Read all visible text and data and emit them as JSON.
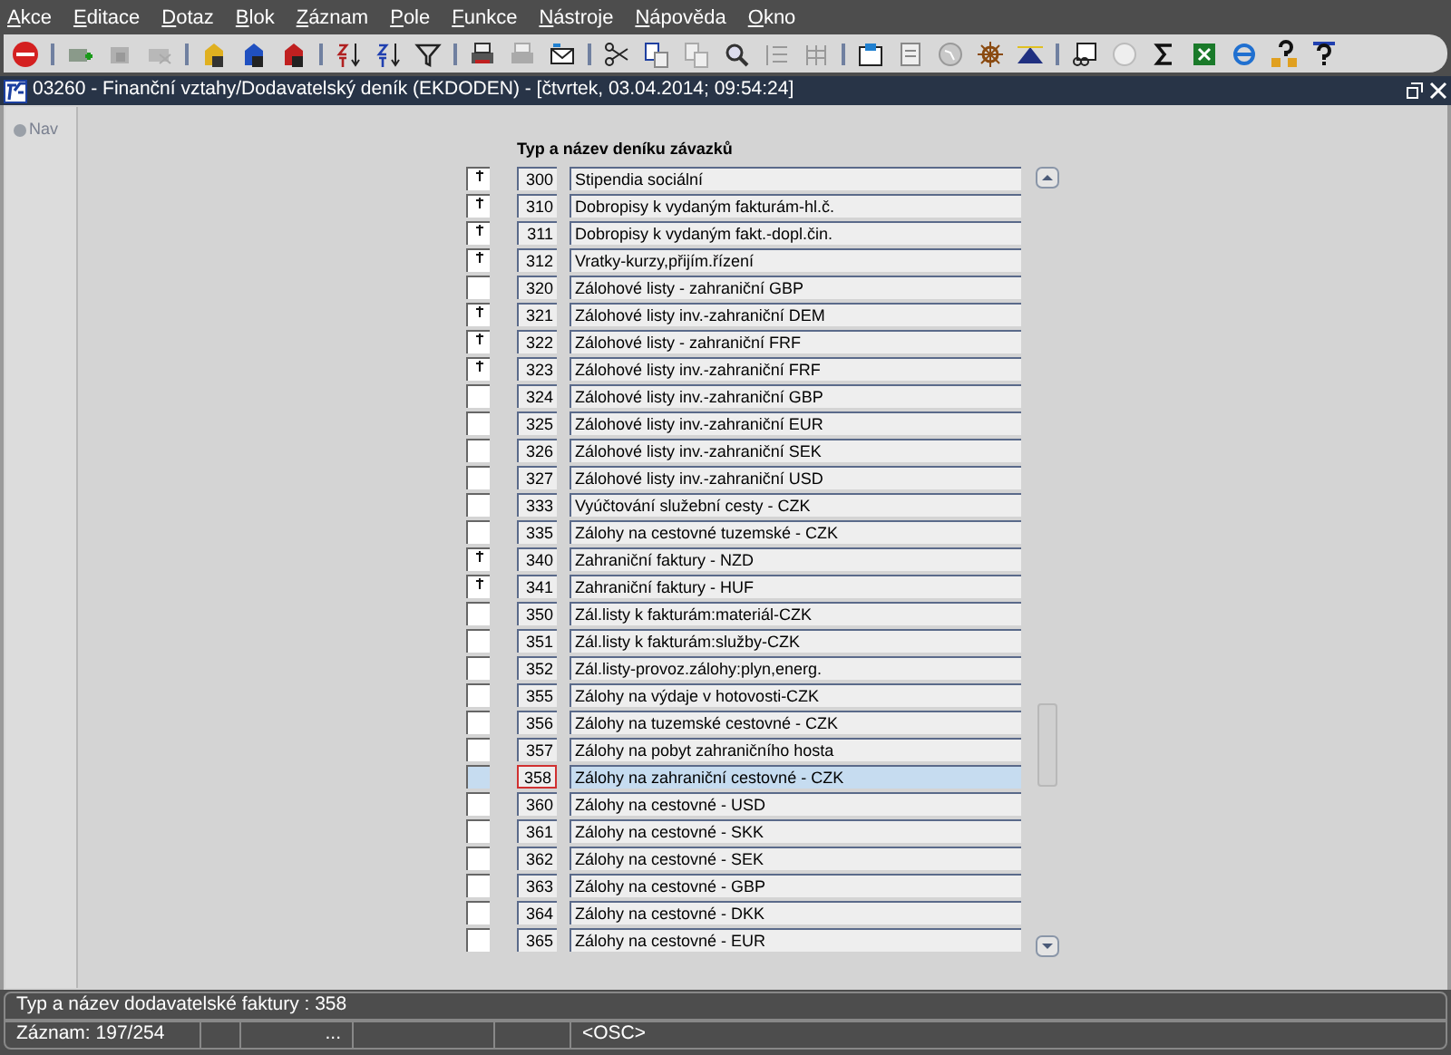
{
  "menu": [
    "Akce",
    "Editace",
    "Dotaz",
    "Blok",
    "Záznam",
    "Pole",
    "Funkce",
    "Nástroje",
    "Nápověda",
    "Okno"
  ],
  "window": {
    "title": "03260 - Finanční vztahy/Dodavatelský deník (EKDODEN) - [čtvrtek, 03.04.2014; 09:54:24]"
  },
  "nav": {
    "label": "Nav"
  },
  "list": {
    "heading": "Typ a název deníku závazků",
    "rows": [
      {
        "code": "300",
        "name": "Stipendia sociální",
        "marked": true,
        "selected": false
      },
      {
        "code": "310",
        "name": "Dobropisy k vydaným fakturám-hl.č.",
        "marked": true,
        "selected": false
      },
      {
        "code": "311",
        "name": "Dobropisy k vydaným fakt.-dopl.čin.",
        "marked": true,
        "selected": false
      },
      {
        "code": "312",
        "name": "Vratky-kurzy,přijím.řízení",
        "marked": true,
        "selected": false
      },
      {
        "code": "320",
        "name": "Zálohové listy - zahraniční GBP",
        "marked": false,
        "selected": false
      },
      {
        "code": "321",
        "name": "Zálohové listy inv.-zahraniční DEM",
        "marked": true,
        "selected": false
      },
      {
        "code": "322",
        "name": "Zálohové listy - zahraniční FRF",
        "marked": true,
        "selected": false
      },
      {
        "code": "323",
        "name": "Zálohové listy inv.-zahraniční FRF",
        "marked": true,
        "selected": false
      },
      {
        "code": "324",
        "name": "Zálohové listy inv.-zahraniční GBP",
        "marked": false,
        "selected": false
      },
      {
        "code": "325",
        "name": "Zálohové listy inv.-zahraniční EUR",
        "marked": false,
        "selected": false
      },
      {
        "code": "326",
        "name": "Zálohové listy inv.-zahraniční SEK",
        "marked": false,
        "selected": false
      },
      {
        "code": "327",
        "name": "Zálohové listy inv.-zahraniční USD",
        "marked": false,
        "selected": false
      },
      {
        "code": "333",
        "name": "Vyúčtování služební cesty - CZK",
        "marked": false,
        "selected": false
      },
      {
        "code": "335",
        "name": "Zálohy na cestovné tuzemské - CZK",
        "marked": false,
        "selected": false
      },
      {
        "code": "340",
        "name": "Zahraniční faktury - NZD",
        "marked": true,
        "selected": false
      },
      {
        "code": "341",
        "name": "Zahraniční faktury - HUF",
        "marked": true,
        "selected": false
      },
      {
        "code": "350",
        "name": "Zál.listy k fakturám:materiál-CZK",
        "marked": false,
        "selected": false
      },
      {
        "code": "351",
        "name": "Zál.listy k fakturám:služby-CZK",
        "marked": false,
        "selected": false
      },
      {
        "code": "352",
        "name": "Zál.listy-provoz.zálohy:plyn,energ.",
        "marked": false,
        "selected": false
      },
      {
        "code": "355",
        "name": "Zálohy na výdaje v hotovosti-CZK",
        "marked": false,
        "selected": false
      },
      {
        "code": "356",
        "name": "Zálohy na tuzemské cestovné - CZK",
        "marked": false,
        "selected": false
      },
      {
        "code": "357",
        "name": "Zálohy na pobyt zahraničního hosta",
        "marked": false,
        "selected": false
      },
      {
        "code": "358",
        "name": "Zálohy na zahraniční cestovné - CZK",
        "marked": false,
        "selected": true
      },
      {
        "code": "360",
        "name": "Zálohy na cestovné - USD",
        "marked": false,
        "selected": false
      },
      {
        "code": "361",
        "name": "Zálohy na cestovné - SKK",
        "marked": false,
        "selected": false
      },
      {
        "code": "362",
        "name": "Zálohy na cestovné - SEK",
        "marked": false,
        "selected": false
      },
      {
        "code": "363",
        "name": "Zálohy na cestovné - GBP",
        "marked": false,
        "selected": false
      },
      {
        "code": "364",
        "name": "Zálohy na cestovné - DKK",
        "marked": false,
        "selected": false
      },
      {
        "code": "365",
        "name": "Zálohy na cestovné - EUR",
        "marked": false,
        "selected": false
      }
    ]
  },
  "status_bar": {
    "hint": "Typ a název dodavatelské faktury : 358",
    "record": "Záznam: 197/254",
    "field_3": "...",
    "mode": "<OSC>"
  }
}
